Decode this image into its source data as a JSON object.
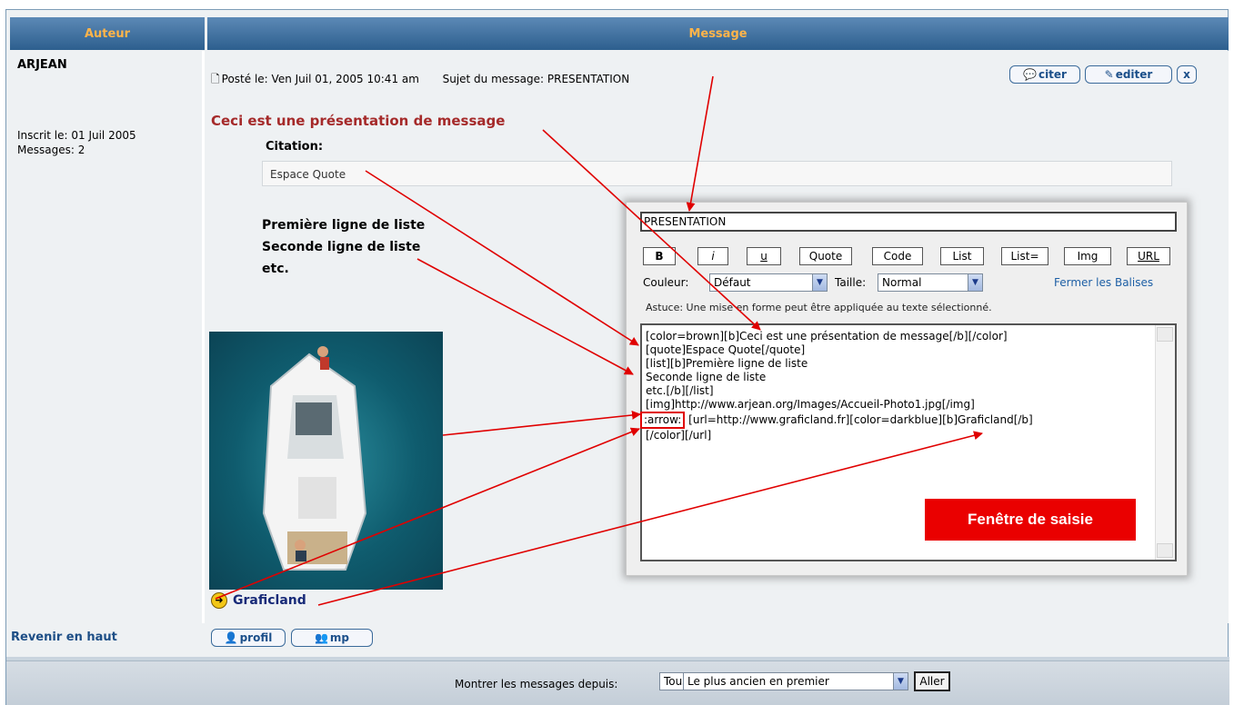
{
  "header": {
    "author_col": "Auteur",
    "message_col": "Message"
  },
  "author": {
    "name": "ARJEAN",
    "joined": "Inscrit le: 01 Juil 2005",
    "posts": "Messages: 2"
  },
  "post": {
    "posted": "Posté le: Ven Juil 01, 2005 10:41 am",
    "subject": "Sujet du message: PRESENTATION",
    "buttons": {
      "quote": "citer",
      "edit": "editer",
      "delete": "x"
    },
    "title": "Ceci est une présentation de message",
    "citation_label": "Citation:",
    "quote_text": "Espace Quote",
    "list_items": [
      "Première ligne de liste",
      "Seconde ligne de liste",
      "etc."
    ],
    "link_text": "Graficland"
  },
  "back_to_top": "Revenir en haut",
  "profile_buttons": {
    "profile": "profil",
    "pm": "mp"
  },
  "editor": {
    "subject_value": "PRESENTATION",
    "toolbar": [
      "B",
      "i",
      "u",
      "Quote",
      "Code",
      "List",
      "List=",
      "Img",
      "URL"
    ],
    "color_label": "Couleur:",
    "color_value": "Défaut",
    "size_label": "Taille:",
    "size_value": "Normal",
    "close_tags": "Fermer les Balises",
    "tip": "Astuce: Une mise en forme peut être appliquée au texte sélectionné.",
    "lines": [
      "[color=brown][b]Ceci est une présentation de message[/b][/color]",
      "[quote]Espace Quote[/quote]",
      "[list][b]Première ligne de liste",
      "Seconde ligne de liste",
      "etc.[/b][/list]",
      "[img]http://www.arjean.org/Images/Accueil-Photo1.jpg[/img]",
      ":arrow:",
      " [url=http://www.graficland.fr][color=darkblue][b]Graficland[/b]",
      "[/color][/url]"
    ],
    "label": "Fenêtre de saisie"
  },
  "footer": {
    "show_label": "Montrer les messages depuis:",
    "range_value": "Tous les messages",
    "order_value": "Le plus ancien en premier",
    "go_label": "Aller"
  },
  "colors": {
    "header": "#2d5f8e",
    "header_text": "#ffb44a",
    "annotation": "#e00000",
    "title": "#a52a2a"
  }
}
